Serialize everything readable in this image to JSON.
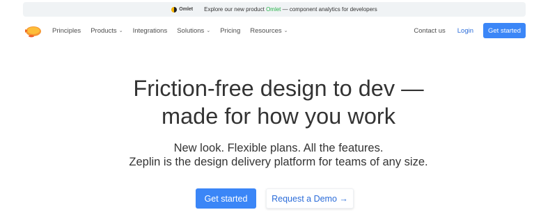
{
  "banner": {
    "omlet_label": "Omlet",
    "text_before": "Explore our new product ",
    "product": "Omlet",
    "text_after": " — component analytics for developers"
  },
  "nav": {
    "items": [
      {
        "label": "Principles"
      },
      {
        "label": "Products"
      },
      {
        "label": "Integrations"
      },
      {
        "label": "Solutions"
      },
      {
        "label": "Pricing"
      },
      {
        "label": "Resources"
      }
    ],
    "contact": "Contact us",
    "login": "Login",
    "get_started": "Get started"
  },
  "hero": {
    "title_line1": "Friction-free design to dev —",
    "title_line2": "made for how you work",
    "sub_line1": "New look. Flexible plans. All the features.",
    "sub_line2": "Zeplin is the design delivery platform for teams of any size.",
    "primary_cta": "Get started",
    "secondary_cta": "Request a Demo →"
  },
  "colors": {
    "accent": "#3b86f7",
    "link": "#2b6cd9",
    "omlet_green": "#27b24a",
    "banner_bg": "#f0f3f5"
  }
}
